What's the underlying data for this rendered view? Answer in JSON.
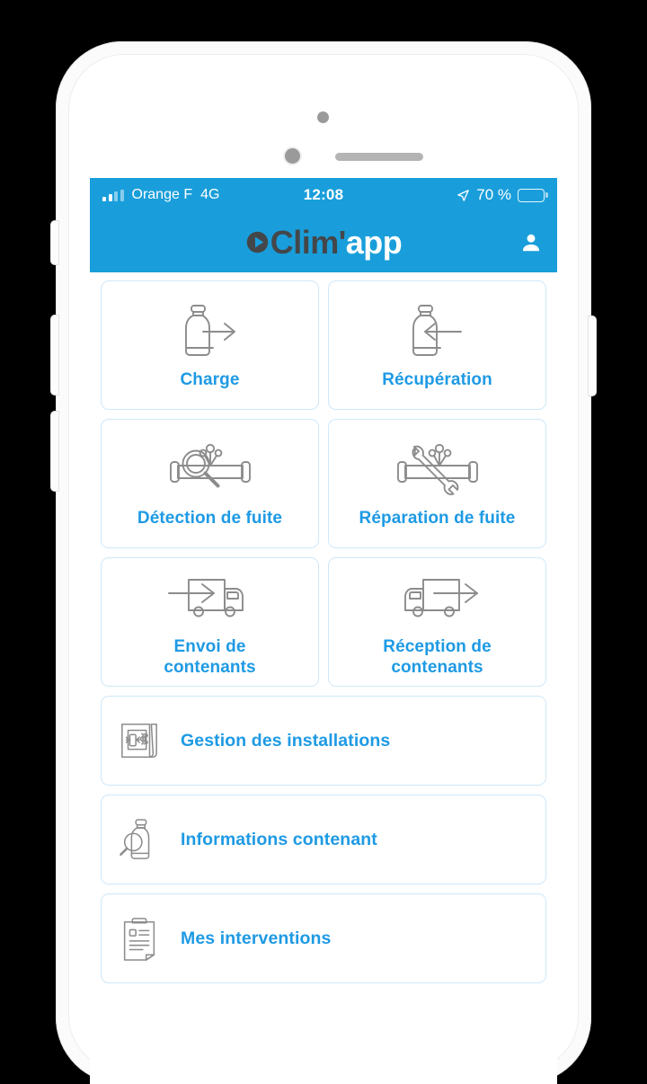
{
  "device": {
    "name": "white-smartphone-mockup",
    "hardware": {
      "front_camera": "camera-icon",
      "proximity_sensor": "sensor-icon",
      "earpiece_speaker": "speaker-grille-icon",
      "mute_switch": "mute-switch",
      "volume_up": "volume-up-button",
      "volume_down": "volume-down-button",
      "power": "power-button"
    }
  },
  "status_bar": {
    "signal_icon": "signal-bars-icon",
    "carrier": "Orange F",
    "network": "4G",
    "time": "12:08",
    "location_icon": "location-arrow-icon",
    "battery_text": "70 %",
    "battery_percent": 70,
    "battery_icon": "battery-icon"
  },
  "header": {
    "logo_mark": "clim-play-mark-icon",
    "logo_part_1": "Clim'",
    "logo_part_2": "app",
    "account_icon": "person-icon"
  },
  "menu": {
    "tiles": [
      {
        "label": "Charge",
        "icon": "cylinder-arrow-right-icon"
      },
      {
        "label": "Récupération",
        "icon": "cylinder-arrow-left-icon"
      },
      {
        "label": "Détection de fuite",
        "icon": "pipe-leak-magnifier-icon"
      },
      {
        "label": "Réparation de fuite",
        "icon": "pipe-leak-wrench-icon"
      },
      {
        "label": "Envoi de\ncontenants",
        "line1": "Envoi de",
        "line2": "contenants",
        "icon": "truck-arrow-in-icon"
      },
      {
        "label": "Réception de\ncontenants",
        "line1": "Réception de",
        "line2": "contenants",
        "icon": "truck-arrow-out-icon"
      }
    ],
    "wide_tiles": [
      {
        "label": "Gestion des installations",
        "icon": "blueprint-icon"
      },
      {
        "label": "Informations contenant",
        "icon": "cylinder-magnifier-icon"
      },
      {
        "label": "Mes interventions",
        "icon": "clipboard-icon"
      }
    ]
  },
  "colors": {
    "brand_blue": "#199edb",
    "label_blue": "#1e9ae4",
    "card_border": "#cfe8fa",
    "icon_gray": "#8c8c8c",
    "logo_dark": "#44474a",
    "background": "#000000"
  }
}
